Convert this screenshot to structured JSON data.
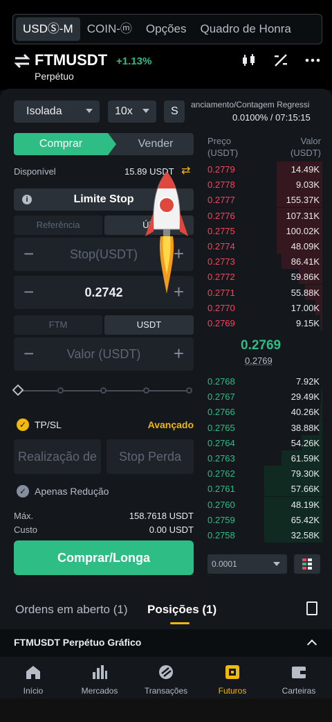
{
  "header": {
    "tabs": [
      {
        "label": "USDⓈ-M",
        "active": true
      },
      {
        "label": "COIN-ⓜ",
        "active": false
      },
      {
        "label": "Opções",
        "active": false
      },
      {
        "label": "Quadro de Honra",
        "active": false
      }
    ],
    "symbol": "FTMUSDT",
    "change": "+1.13%",
    "contract_type": "Perpétuo",
    "icons": [
      "candlestick-chart-icon",
      "percent-calculator-icon",
      "more-icon"
    ]
  },
  "controls": {
    "margin_mode": "Isolada",
    "leverage": "10x",
    "s_button": "S"
  },
  "funding": {
    "label": "Financiamento/Contagem Regressiva",
    "label_visible": "anciamento/Contagem Regressi",
    "value": "0.0100% / 07:15:15"
  },
  "order_form": {
    "buy_tab": "Comprar",
    "sell_tab": "Vender",
    "available_label": "Disponível",
    "available_value": "15.89 USDT",
    "order_type": "Limite Stop",
    "price_source_tabs": [
      "Referência",
      "Últi"
    ],
    "stop_placeholder": "Stop(USDT)",
    "price_value": "0.2742",
    "unit_tabs": [
      "FTM",
      "USDT"
    ],
    "amount_placeholder": "Valor (USDT)",
    "slider_percent": 0,
    "tpsl_label": "TP/SL",
    "advanced_label": "Avançado",
    "take_profit_placeholder": "Realização de",
    "stop_loss_placeholder": "Stop Perda",
    "reduce_only_label": "Apenas Redução",
    "max_label": "Máx.",
    "max_value": "158.7618 USDT",
    "cost_label": "Custo",
    "cost_value": "0.00 USDT",
    "submit_label": "Comprar/Longa"
  },
  "orderbook": {
    "price_header": "Preço\n(USDT)",
    "price_header_1": "Preço",
    "price_header_2": "(USDT)",
    "value_header_1": "Valor",
    "value_header_2": "(USDT)",
    "asks": [
      {
        "price": "0.2779",
        "value": "14.49K",
        "depth": 0.39
      },
      {
        "price": "0.2778",
        "value": "9.03K",
        "depth": 0.39
      },
      {
        "price": "0.2777",
        "value": "155.37K",
        "depth": 0.39
      },
      {
        "price": "0.2776",
        "value": "107.31K",
        "depth": 0.39
      },
      {
        "price": "0.2775",
        "value": "100.02K",
        "depth": 0.39
      },
      {
        "price": "0.2774",
        "value": "48.09K",
        "depth": 0.39
      },
      {
        "price": "0.2773",
        "value": "86.41K",
        "depth": 0.35
      },
      {
        "price": "0.2772",
        "value": "59.86K",
        "depth": 0.2
      },
      {
        "price": "0.2771",
        "value": "55.88K",
        "depth": 0.15
      },
      {
        "price": "0.2770",
        "value": "17.00K",
        "depth": 0.06
      },
      {
        "price": "0.2769",
        "value": "9.15K",
        "depth": 0.02
      }
    ],
    "mid_price": "0.2769",
    "mark_price": "0.2769",
    "bids": [
      {
        "price": "0.2768",
        "value": "7.92K",
        "depth": 0.0
      },
      {
        "price": "0.2767",
        "value": "29.49K",
        "depth": 0.01
      },
      {
        "price": "0.2766",
        "value": "40.26K",
        "depth": 0.02
      },
      {
        "price": "0.2765",
        "value": "38.88K",
        "depth": 0.03
      },
      {
        "price": "0.2764",
        "value": "54.26K",
        "depth": 0.18
      },
      {
        "price": "0.2763",
        "value": "61.59K",
        "depth": 0.35
      },
      {
        "price": "0.2762",
        "value": "79.30K",
        "depth": 0.5
      },
      {
        "price": "0.2761",
        "value": "57.66K",
        "depth": 0.5
      },
      {
        "price": "0.2760",
        "value": "48.19K",
        "depth": 0.5
      },
      {
        "price": "0.2759",
        "value": "65.42K",
        "depth": 0.5
      },
      {
        "price": "0.2758",
        "value": "32.58K",
        "depth": 0.5
      }
    ],
    "precision": "0.0001"
  },
  "positions": {
    "open_orders_tab": "Ordens em aberto (1)",
    "positions_tab": "Posições (1)",
    "bar_title": "FTMUSDT Perpétuo  Gráfico"
  },
  "nav": [
    {
      "label": "Início",
      "icon": "home-icon"
    },
    {
      "label": "Mercados",
      "icon": "markets-icon"
    },
    {
      "label": "Transações",
      "icon": "trade-icon"
    },
    {
      "label": "Futuros",
      "icon": "futures-icon",
      "active": true
    },
    {
      "label": "Carteiras",
      "icon": "wallet-icon"
    }
  ],
  "colors": {
    "green": "#2ebd85",
    "red": "#f6465d",
    "accent": "#f0b90b",
    "background": "#0b0e11"
  }
}
